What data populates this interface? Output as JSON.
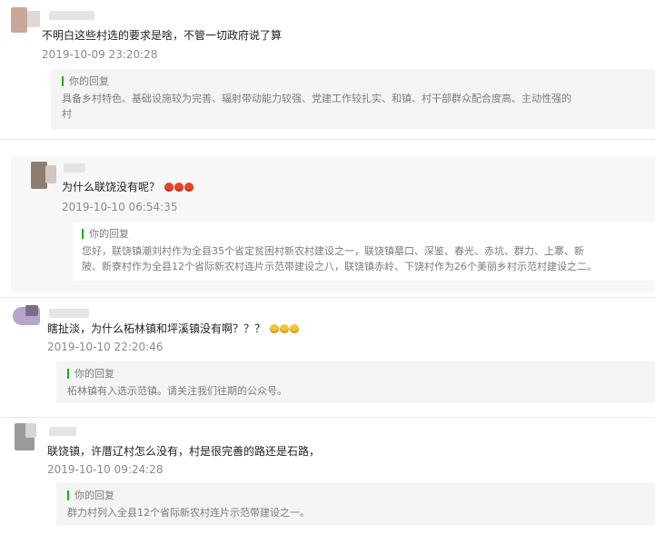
{
  "reply_label": "你的回复",
  "accent_color": "#1aad19",
  "comments": [
    {
      "text": "不明白这些村选的要求是啥，不管一切政府说了算",
      "time": "2019-10-09 23:20:28",
      "reply_lines": [
        "具备乡村特色、基础设施较为完善、辐射带动能力较强、党建工作较扎实、和镇、村干部群众配合度高、主动性强的",
        "村"
      ]
    },
    {
      "text": "为什么联饶没有呢？",
      "emoji": "red-face-icon x3",
      "time": "2019-10-10 06:54:35",
      "reply_lines": [
        "您好，联饶镇潮刘村作为全县35个省定贫困村新农村建设之一，联饶镇墓口、深鉴、春光、赤坑、群力、上寨、新",
        "陂、新寮村作为全县12个省际新农村连片示范带建设之八，联饶镇赤岭、下饶村作为26个美丽乡村示范村建设之二。"
      ]
    },
    {
      "text": "瞎扯淡，为什么柘林镇和坪溪镇没有啊？？？",
      "emoji": "laughing-face-icon x3",
      "time": "2019-10-10 22:20:46",
      "reply_lines": [
        "柘林镇有入选示范镇。请关注我们往期的公众号。"
      ]
    },
    {
      "text": "联饶镇，许厝辽村怎么没有，村是很完善的路还是石路，",
      "time": "2019-10-10 09:24:28",
      "reply_lines": [
        "群力村列入全县12个省际新农村连片示范带建设之一。"
      ]
    }
  ]
}
